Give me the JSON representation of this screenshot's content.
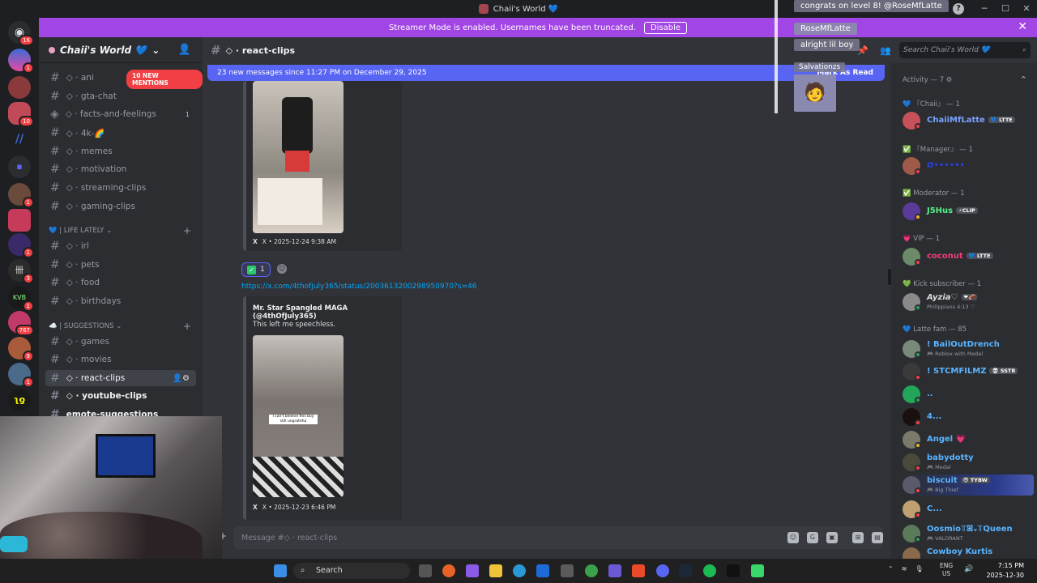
{
  "window": {
    "title": "Chaii's World 💙",
    "help": "?"
  },
  "banner": {
    "text": "Streamer Mode is enabled. Usernames have been truncated.",
    "disable_label": "Disable",
    "close": "✕"
  },
  "server": {
    "name": "Chaii's World 💙",
    "dropdown": "⌄",
    "add_people": "👤",
    "mentions_badge": "10 NEW MENTIONS"
  },
  "guild_badges": [
    "16",
    "1",
    "10",
    "1",
    "1",
    "3",
    "1",
    "767",
    "9",
    "1"
  ],
  "channels": [
    {
      "label": "◇ · ani",
      "name": "ch-anime"
    },
    {
      "label": "◇ · gta-chat",
      "name": "ch-gta-chat"
    },
    {
      "label": "◇ · facts-and-feelings",
      "count": "1",
      "name": "ch-facts-and-feelings"
    },
    {
      "label": "◇ · 4k-🌈",
      "name": "ch-4k"
    },
    {
      "label": "◇ · memes",
      "name": "ch-memes"
    },
    {
      "label": "◇ · motivation",
      "name": "ch-motivation"
    },
    {
      "label": "◇ · streaming-clips",
      "name": "ch-streaming-clips"
    },
    {
      "label": "◇ · gaming-clips",
      "name": "ch-gaming-clips"
    },
    {
      "label": "◇ · irl",
      "name": "ch-irl"
    },
    {
      "label": "◇ · pets",
      "name": "ch-pets"
    },
    {
      "label": "◇ · food",
      "name": "ch-food"
    },
    {
      "label": "◇ · birthdays",
      "name": "ch-birthdays"
    },
    {
      "label": "◇ · games",
      "name": "ch-games"
    },
    {
      "label": "◇ · movies",
      "name": "ch-movies"
    },
    {
      "label": "◇ · react-clips",
      "name": "ch-react-clips"
    },
    {
      "label": "◇ · youtube-clips",
      "name": "ch-youtube-clips"
    },
    {
      "label": "emote-suggestions",
      "name": "ch-emote-suggestions"
    }
  ],
  "categories": {
    "life": "💙 | LIFE LATELY ⌄",
    "suggestions": "☁️ | SUGGESTIONS ⌄",
    "plus": "+"
  },
  "channel_header": {
    "name": "◇ · react-clips",
    "search_placeholder": "Search Chaii's World 💙"
  },
  "new_messages": {
    "text": "23 new messages since 11:27 PM on December 29, 2025",
    "mark_read": "Mark As Read"
  },
  "embeds": [
    {
      "footer": "X • 2025-12-24 9:38 AM",
      "xlogo": "X"
    },
    {
      "author": "Mr. Star Spangled MAGA (@4thOfJuly365)",
      "description": "This left me speechless.",
      "footer": "X • 2025-12-23 6:46 PM",
      "xlogo": "X",
      "video_caption": "I can't believe this boy still ungrateful"
    }
  ],
  "reaction": {
    "emoji": "✓",
    "count": "1"
  },
  "link": "https://x.com/4thofjuly365/status/2003613200298950970?s=46",
  "composer": {
    "placeholder": "Message #◇ · react-clips",
    "plus": "+"
  },
  "overlay": {
    "congrats": "congrats on level 8! @RoseMfLatte",
    "user": "RoseMfLatte",
    "msg": "alright lil boy",
    "user2": "Salvationzs"
  },
  "members": {
    "activity": "Activity — 7 ⚙",
    "groups": [
      {
        "header": "💙 『Chaii』 — 1",
        "members": [
          {
            "name": "ChaiiMfLatte",
            "tag": "💙 LTTE",
            "color": "#7aa2ff"
          }
        ]
      },
      {
        "header": "✅ 『Manager』 — 1",
        "members": [
          {
            "name": "Ø••••••",
            "tag": "",
            "color": "#2b3fd6"
          }
        ]
      },
      {
        "header": "✅ Moderator — 1",
        "members": [
          {
            "name": "J5Hus",
            "tag": "⚡CLIP",
            "color": "#57f287"
          }
        ]
      },
      {
        "header": "💗 VIP — 1",
        "members": [
          {
            "name": "coconut",
            "tag": "💙 LTTE",
            "color": "#f23f7a"
          }
        ]
      },
      {
        "header": "💚 Kick subscriber — 1",
        "members": [
          {
            "name": "Ayzia♡",
            "tag": "❤🏈",
            "sub": "Philippians 4:13 ♡",
            "color": "#dbdee1"
          }
        ]
      },
      {
        "header": "💙 Latte fam — 85",
        "members": [
          {
            "name": "! BailOutDrench",
            "sub": "🎮 Roblox with Medal",
            "color": "#5ab4ff"
          },
          {
            "name": "! STCMFILMZ",
            "tag": "💀 SSTR",
            "color": "#5ab4ff"
          },
          {
            "name": "..",
            "color": "#5ab4ff"
          },
          {
            "name": "4...",
            "color": "#5ab4ff"
          },
          {
            "name": "Angel 💗",
            "color": "#5ab4ff"
          },
          {
            "name": "babydotty",
            "sub": "🎮 Medal",
            "color": "#5ab4ff"
          },
          {
            "name": "biscuit",
            "tag": "😎 TYBW",
            "sub": "🎮 Big Thief",
            "color": "#5ab4ff"
          },
          {
            "name": "C...",
            "color": "#5ab4ff"
          },
          {
            "name": "Oosmio𝕋ꕤᵥ𝕋Queen",
            "sub": "🎮 VALORANT",
            "color": "#5ab4ff"
          },
          {
            "name": "Cowboy Kurtis",
            "color": "#5ab4ff"
          }
        ]
      }
    ]
  },
  "taskbar": {
    "search": "Search",
    "time": "7:15 PM",
    "date": "2025-12-30",
    "lang": "ENG",
    "region": "US"
  },
  "colors": {
    "accent": "#5865f2",
    "banner": "#a245e5",
    "link": "#00a8fc",
    "danger": "#f23f43"
  }
}
